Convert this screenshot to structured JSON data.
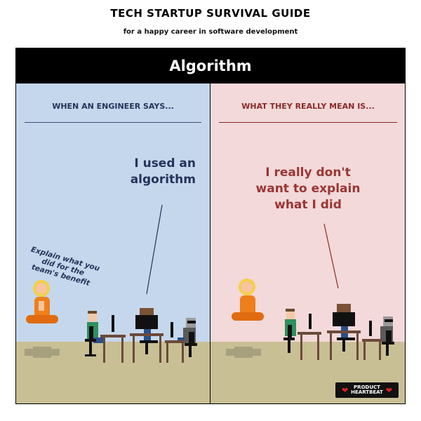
{
  "page": {
    "title": "TECH STARTUP SURVIVAL GUIDE",
    "subtitle": "for a happy career in software development"
  },
  "comic": {
    "header": "Algorithm",
    "left": {
      "heading": "WHEN AN ENGINEER SAYS...",
      "speech_line1": "I used an",
      "speech_line2": "algorithm",
      "aside_line1": "Explain what you",
      "aside_line2": "did for the",
      "aside_line3": "team's benefit"
    },
    "right": {
      "heading": "WHAT THEY REALLY MEAN IS...",
      "speech_line1": "I really don't",
      "speech_line2": "want to explain",
      "speech_line3": "what I did"
    },
    "badge": {
      "line1": "PRODUCT",
      "line2": "HEARTBEAT"
    }
  }
}
